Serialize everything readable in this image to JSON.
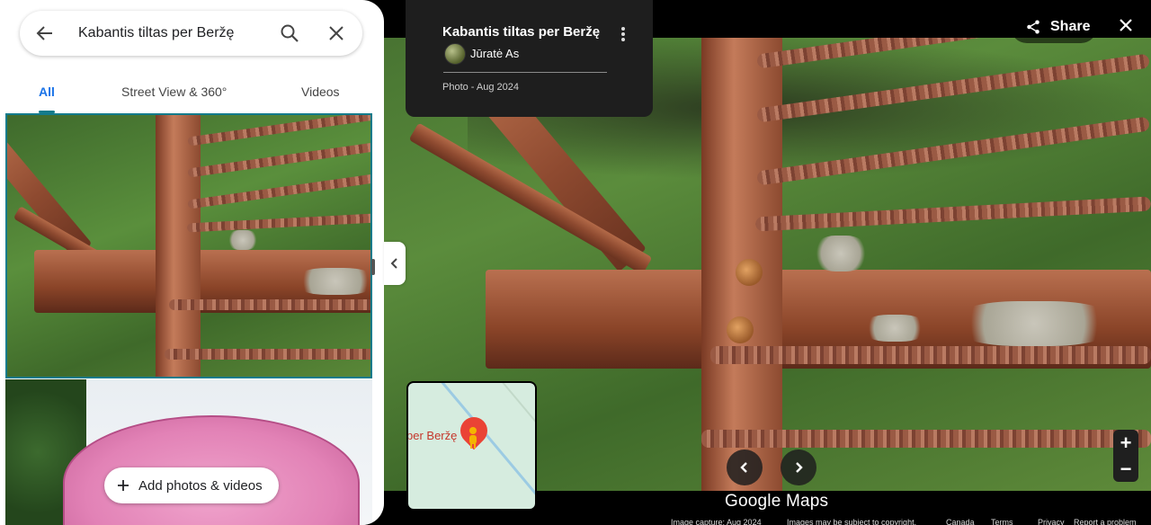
{
  "search": {
    "value": "Kabantis tiltas per Beržę"
  },
  "tabs": [
    {
      "label": "All",
      "active": true
    },
    {
      "label": "Street View & 360°",
      "active": false
    },
    {
      "label": "Videos",
      "active": false
    }
  ],
  "add_media": {
    "label": "Add photos & videos"
  },
  "photo_info": {
    "title": "Kabantis tiltas per Beržę",
    "author": "Jūratė As",
    "meta": "Photo - Aug 2024"
  },
  "header": {
    "share_label": "Share"
  },
  "minimap": {
    "label": "per Beržę"
  },
  "zoom": {
    "in": "+",
    "out": "−"
  },
  "brand": "Google Maps",
  "footer": {
    "capture": "Image capture: Aug 2024",
    "copyright": "Images may be subject to copyright.",
    "country": "Canada",
    "terms": "Terms",
    "privacy": "Privacy",
    "report": "Report a problem"
  },
  "colors": {
    "accent": "#1a73e8",
    "teal": "#137b8b",
    "pin": "#ea4335"
  }
}
